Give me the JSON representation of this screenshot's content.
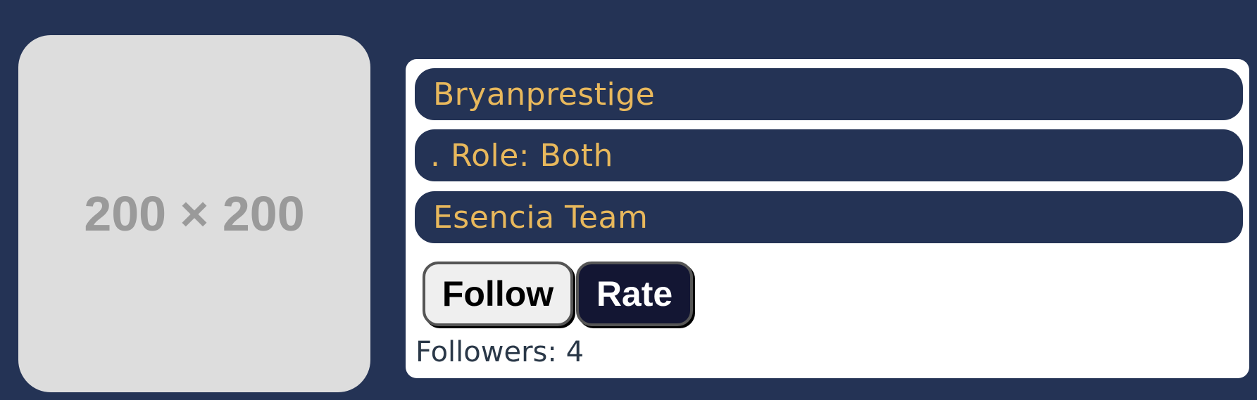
{
  "avatar": {
    "placeholder_text": "200 × 200"
  },
  "profile": {
    "username": "Bryanprestige",
    "role": ". Role: Both",
    "team": "Esencia Team"
  },
  "actions": {
    "follow_label": "Follow",
    "rate_label": "Rate"
  },
  "followers": {
    "label": "Followers: ",
    "count": "4"
  },
  "colors": {
    "page_background": "#243355",
    "pill_background": "#243355",
    "pill_text": "#e8b85c",
    "card_background": "#ffffff",
    "follow_button_background": "#efefef",
    "rate_button_background": "#131633",
    "avatar_background": "#dddddd"
  }
}
